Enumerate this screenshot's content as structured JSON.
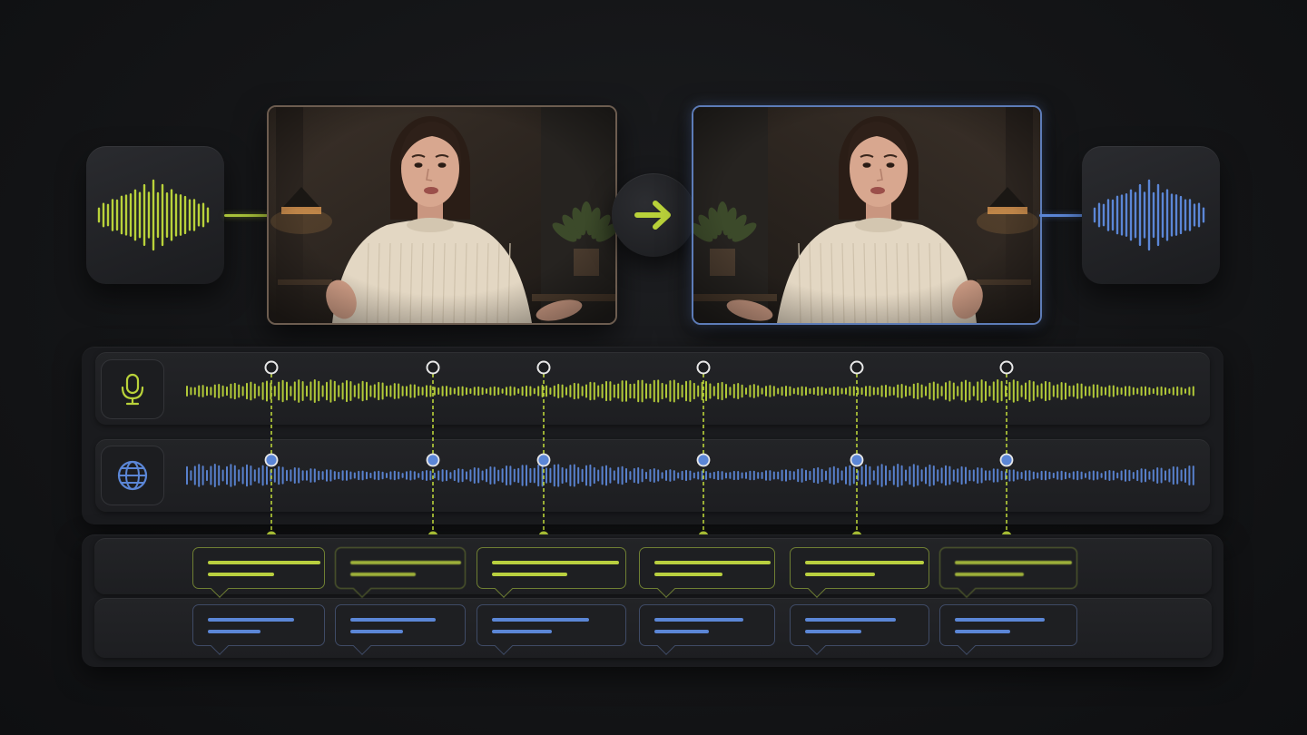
{
  "colors": {
    "accent_green": "#b9d23a",
    "accent_blue": "#5b86d6",
    "background": "#141517",
    "panel": "#1a1b1e"
  },
  "icons": {
    "arrow": "arrow-right-icon",
    "source_track": "microphone-icon",
    "target_track": "globe-icon"
  },
  "sync_markers": {
    "count": 6
  },
  "captions": {
    "source_count": 6,
    "translated_count": 6
  }
}
